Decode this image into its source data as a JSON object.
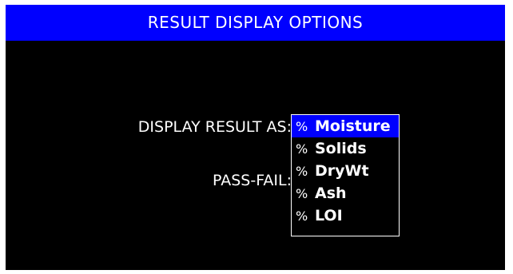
{
  "header": {
    "title": "RESULT DISPLAY OPTIONS"
  },
  "form": {
    "display_result_label": "DISPLAY RESULT AS:",
    "pass_fail_label": "PASS-FAIL:"
  },
  "dropdown": {
    "selected_index": 0,
    "options": [
      {
        "prefix": "%",
        "label": "Moisture"
      },
      {
        "prefix": "%",
        "label": "Solids"
      },
      {
        "prefix": "%",
        "label": "DryWt"
      },
      {
        "prefix": "%",
        "label": "Ash"
      },
      {
        "prefix": "%",
        "label": "LOI"
      }
    ]
  },
  "colors": {
    "title_bar": "#0000ff",
    "background": "#000000",
    "text": "#ffffff",
    "selection": "#0000ff"
  }
}
